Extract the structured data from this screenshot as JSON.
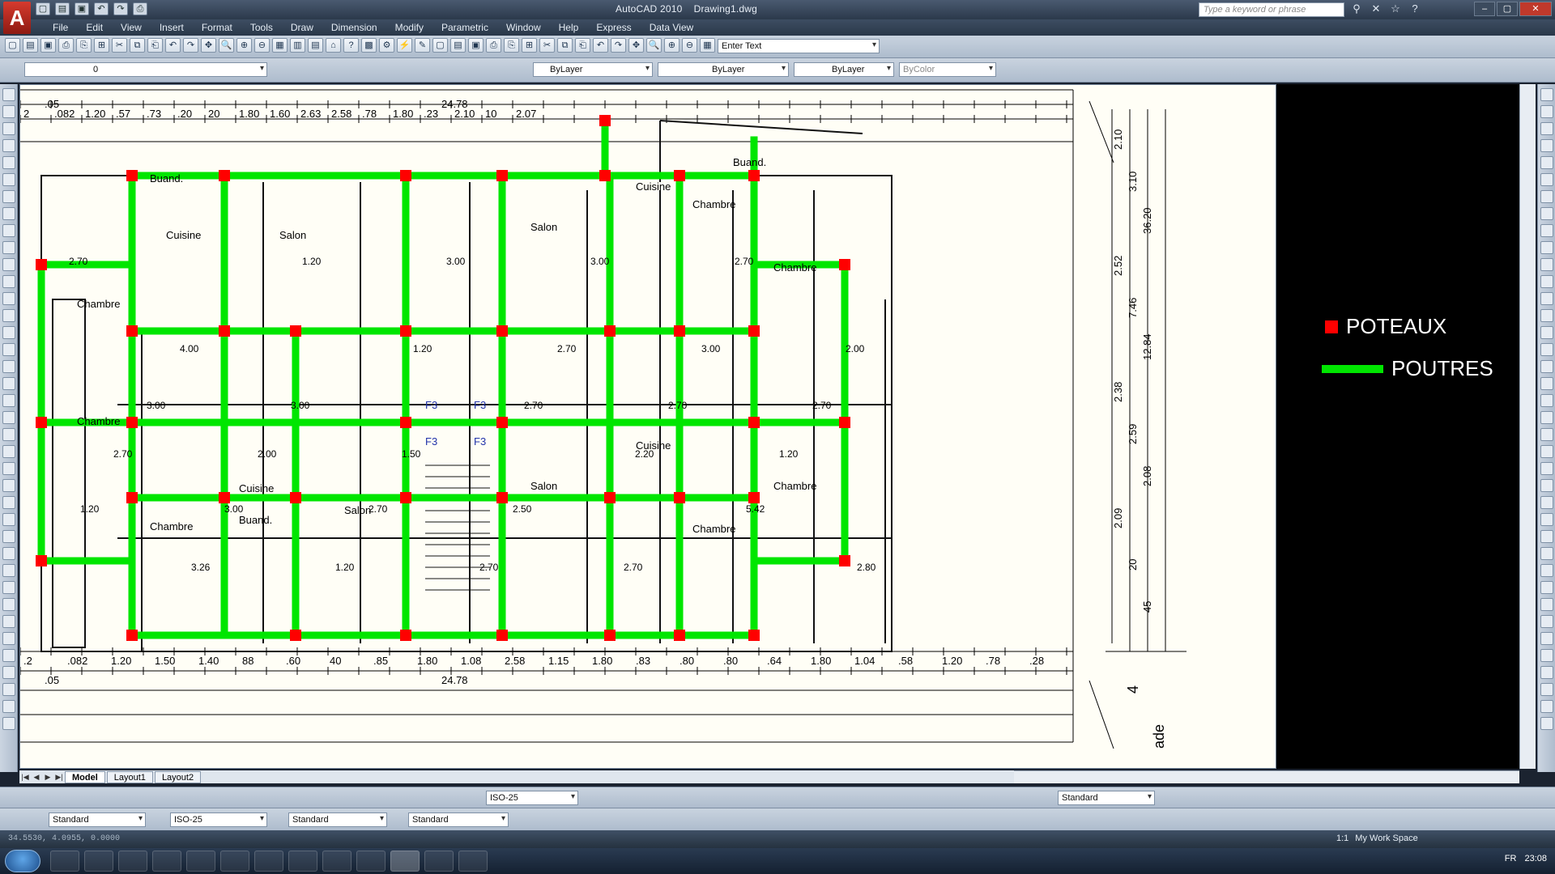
{
  "titlebar": {
    "app_name": "AutoCAD 2010",
    "document": "Drawing1.dwg",
    "search_placeholder": "Type a keyword or phrase"
  },
  "menu": [
    "File",
    "Edit",
    "View",
    "Insert",
    "Format",
    "Tools",
    "Draw",
    "Dimension",
    "Modify",
    "Parametric",
    "Window",
    "Help",
    "Express",
    "Data View"
  ],
  "toolbar": {
    "text_input_placeholder": "Enter Text",
    "layer_current": "0",
    "color": "ByLayer",
    "linetype": "ByLayer",
    "lineweight": "ByLayer",
    "plotstyle": "ByColor"
  },
  "bottom_toolbars": {
    "dim_style": "ISO-25",
    "table_style": "Standard",
    "text_style": "Standard",
    "dim_style_2": "ISO-25",
    "multileader_style": "Standard",
    "table_style_2": "Standard",
    "mleader_right": "Standard"
  },
  "layout_tabs": [
    "Model",
    "Layout1",
    "Layout2"
  ],
  "status": {
    "coords": "34.5530, 4.0955, 0.0000",
    "scale": "1:1",
    "workspace": "My Work Space",
    "lang": "FR",
    "time": "23:08"
  },
  "legend": {
    "poteaux": "POTEAUX",
    "poutres": "POUTRES"
  },
  "plan": {
    "top_dims": [
      "2",
      ".082",
      "1.20",
      ".57",
      ".73",
      ".20",
      "20",
      "1.80",
      "1.60",
      "2.63",
      "2.58",
      ".78",
      "1.80",
      ".23",
      "2.10",
      "10",
      "2.07"
    ],
    "total_top": "24.78",
    "total_bottom": "24.78",
    "offset": ".05",
    "bottom_dims": [
      ".2",
      ".082",
      "1.20",
      "1.50",
      "1.40",
      "88",
      ".60",
      "40",
      ".85",
      "1.80",
      "1.08",
      "2.58",
      "1.15",
      "1.80",
      ".83",
      ".80",
      ".80",
      ".64",
      "1.80",
      "1.04",
      ".58",
      "1.20",
      ".78",
      ".28"
    ],
    "right_dims": [
      "2.10",
      "3.10",
      "36.20",
      "2.52",
      "7.46",
      "12.84",
      "2.38",
      "2.59",
      "2.08",
      "2.09",
      "20",
      "45"
    ],
    "rooms": [
      "Buand.",
      "Cuisine",
      "Chambre",
      "Salon",
      "Buand.",
      "Chambre",
      "Chambre",
      "Cuisine",
      "Salon",
      "Chambre",
      "Chambre",
      "Buand.",
      "Cuisine",
      "Salon",
      "Chambre",
      "Chambre",
      "Cuisine",
      "Salon",
      "F3",
      "F3",
      "F3",
      "F3"
    ],
    "row_dims": [
      "2.70",
      "4.00",
      "3.00",
      "1.50",
      "2.50",
      "2.70",
      "2.70",
      "2.00",
      "3.00",
      "2.00",
      "2.70",
      "2.70",
      "3.00",
      "3.00",
      "2.70",
      "2.70",
      "3.00",
      "1.20",
      "3.00",
      "2.70",
      "2.70",
      "1.20",
      "1.20",
      "3.26",
      "1.20",
      "1.20",
      "2.70",
      "2.20",
      "5.42",
      "2.80"
    ],
    "axis_label": "4",
    "facade_label": "ade"
  }
}
